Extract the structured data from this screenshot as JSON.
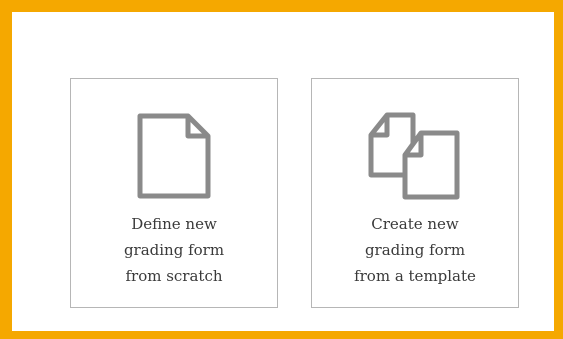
{
  "colors": {
    "frame_border": "#f5a800",
    "card_border": "#b6b6b6",
    "icon_stroke": "#8a8a8a",
    "text": "#3a3a3a"
  },
  "options": [
    {
      "icon": "document-icon",
      "lines": [
        "Define new",
        "grading form",
        "from scratch"
      ]
    },
    {
      "icon": "copy-documents-icon",
      "lines": [
        "Create new",
        "grading form",
        "from a template"
      ]
    }
  ]
}
